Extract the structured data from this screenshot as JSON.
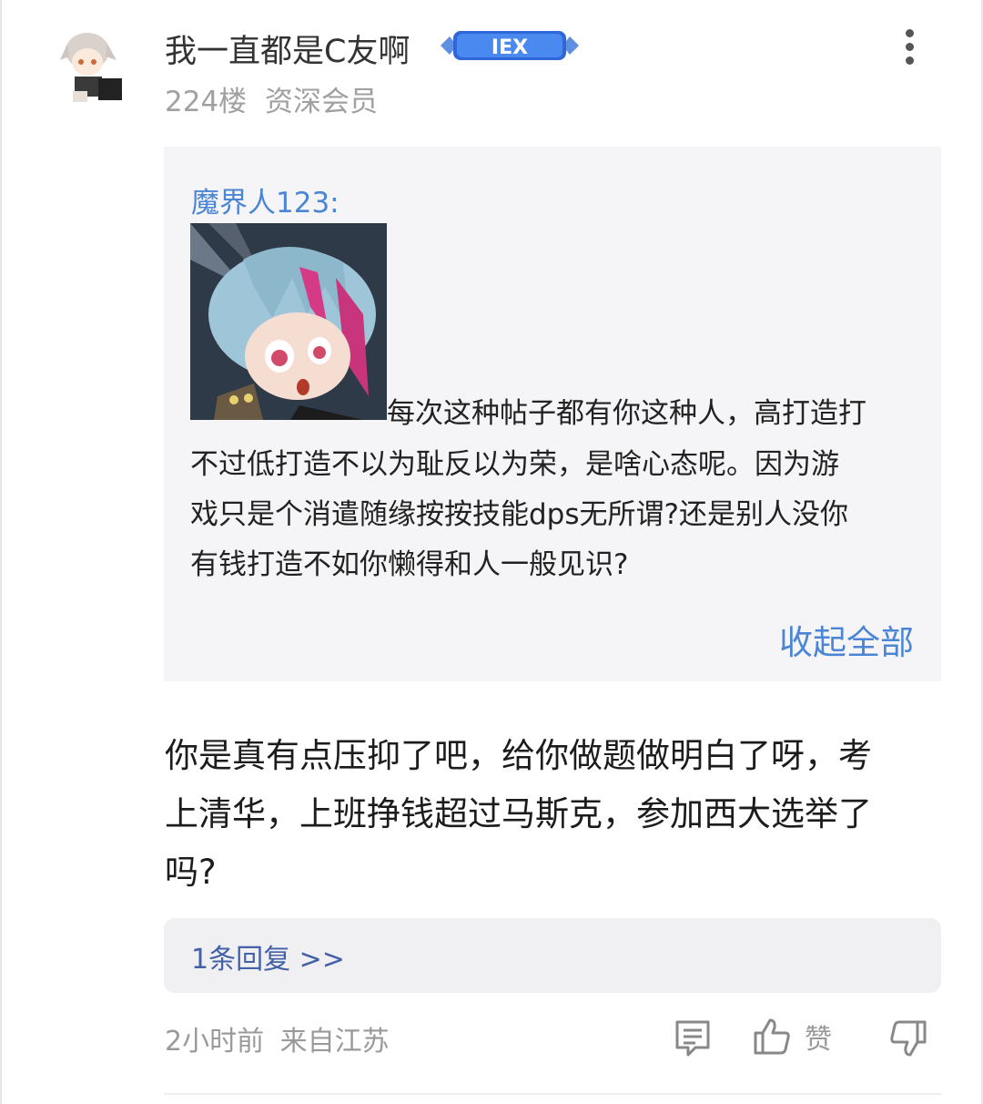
{
  "post": {
    "username": "我一直都是C友啊",
    "level_badge": "IEX",
    "floor": "224楼",
    "member_title": "资深会员"
  },
  "quote": {
    "author": "魔界人123:",
    "text_lines": [
      "每次这种帖子都有你这种人，高打造打",
      "不过低打造不以为耻反以为荣，是啥心态呢。因为游",
      "戏只是个消遣随缘按按技能dps无所谓?还是别人没你",
      "有钱打造不如你懒得和人一般见识?"
    ],
    "collapse_label": "收起全部"
  },
  "reply": {
    "lines": [
      "你是真有点压抑了吧，给你做题做明白了呀，考",
      "上清华，上班挣钱超过马斯克，参加西大选举了",
      "吗?"
    ]
  },
  "sub_replies": {
    "label": "1条回复 >>"
  },
  "footer": {
    "time": "2小时前",
    "location": "来自江苏",
    "like_label": "赞",
    "icons": [
      "comment-icon",
      "thumbs-up-icon",
      "thumbs-down-icon"
    ]
  },
  "colors": {
    "link_blue": "#4b85d6",
    "subreply_blue": "#4461a8",
    "quote_bg": "#f5f5f7",
    "meta_gray": "#9a9a9a"
  }
}
